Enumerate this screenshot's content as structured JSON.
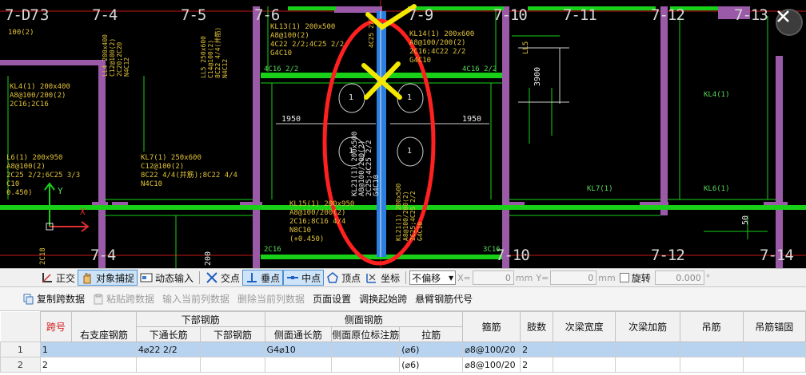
{
  "cad": {
    "axis_labels_top": [
      "7-D7",
      "3",
      "7-4",
      "7-5",
      "7-6",
      "7-9",
      "7-10",
      "7-11",
      "7-12",
      "7-13"
    ],
    "axis_labels_bottom": [
      "7-4",
      "7-10",
      "7-12",
      "7-14"
    ],
    "texts": {
      "kl4_header": "100(2)",
      "kl4": "KL4(1) 200x400\nA8@100/200(2)\n2C16;2C16",
      "kl6": "L6(1) 200x950\nA8@100(2)\n2C25 2/2;6C25 3/3\nC10\n0.450)",
      "kl7": "KL7(1) 250x600\nC12@100(2)\n8C22 4/4(并筋);8C22 4/4\nN4C10",
      "kl13": "KL13(1) 200x500\nA8@100(2)\n4C22 2/2;4C25 2/2\nG4C10",
      "kl14": "KL14(1) 200x600\nA8@100/200(2)\n2C16;4C22 2/2\nG4C10",
      "kl15": "KL15(1) 200x950\nA8@100/200(2)\n2C16;8C16 4/4\nN8C10\n(+0.450)",
      "ll4": "LL4 200x400\nC12@100(2)\n2C20;2C20\nN4C12",
      "ll5": "LL5 250x600\nC14@100(2)\n8C22 4/4(并筋)\nN4C12",
      "kl21": "KL21(1) 200x500\nA8@100/200(2)\n2C25;4C25 2/2\nG4C10",
      "kl21b": "KL21(1) 200x500\nA8@100/200(2)\n2C25;4C25 2/2\nG4C10",
      "c4c25": "4C25 2/2",
      "c4c16_a": "4C16 2/2",
      "c4c16_b": "4C16 2/2",
      "c3c16": "3C16",
      "c2c16": "2C16",
      "kl4_right": "KL4(1)",
      "kl7_right": "KL7(1)",
      "kl6_right": "KL6(1)",
      "dim_1950_left": "1950",
      "dim_1950_right": "1950",
      "dim_3900": "3900",
      "dim_200": "200",
      "dim_50": "50",
      "dim_2c18": "2C18",
      "ll5_short": "LL5",
      "circle_1": "1",
      "axis_y": "Y",
      "axis_x": "X"
    }
  },
  "snapbar": {
    "ortho": "正交",
    "object_snap": "对象捕捉",
    "dynamic_input": "动态输入",
    "intersection": "交点",
    "perpendicular": "垂点",
    "midpoint": "中点",
    "vertex": "顶点",
    "coordinate": "坐标",
    "offset_select": "不偏移",
    "x_label": "X=",
    "x_value": "0",
    "x_unit": "mm",
    "y_label": "Y=",
    "y_value": "0",
    "y_unit": "mm",
    "rotate": "旋转",
    "rotate_value": "0.000",
    "deg": "°"
  },
  "datatb": {
    "copy_span": "复制跨数据",
    "paste_span": "粘贴跨数据",
    "input_col": "输入当前列数据",
    "delete_col": "删除当前列数据",
    "page_setup": "页面设置",
    "swap_start": "调换起始跨",
    "cantilever_code": "悬臂钢筋代号"
  },
  "grid": {
    "group_headers": {
      "bottom": "下部钢筋",
      "side": "侧面钢筋"
    },
    "headers": [
      "跨号",
      "右支座钢筋",
      "下通长筋",
      "下部钢筋",
      "侧面通长筋",
      "侧面原位标注筋",
      "拉筋",
      "箍筋",
      "肢数",
      "次梁宽度",
      "次梁加筋",
      "吊筋",
      "吊筋锚固"
    ],
    "rows": [
      {
        "idx": "1",
        "cells": [
          "1",
          "",
          "4⌀22 2/2",
          "",
          "G4⌀10",
          "",
          "(⌀6)",
          "⌀8@100/20",
          "2",
          "",
          "",
          "",
          ""
        ]
      },
      {
        "idx": "2",
        "cells": [
          "2",
          "",
          "",
          "",
          "",
          "",
          "(⌀6)",
          "⌀8@100/20",
          "2",
          "",
          "",
          "",
          ""
        ]
      }
    ]
  }
}
